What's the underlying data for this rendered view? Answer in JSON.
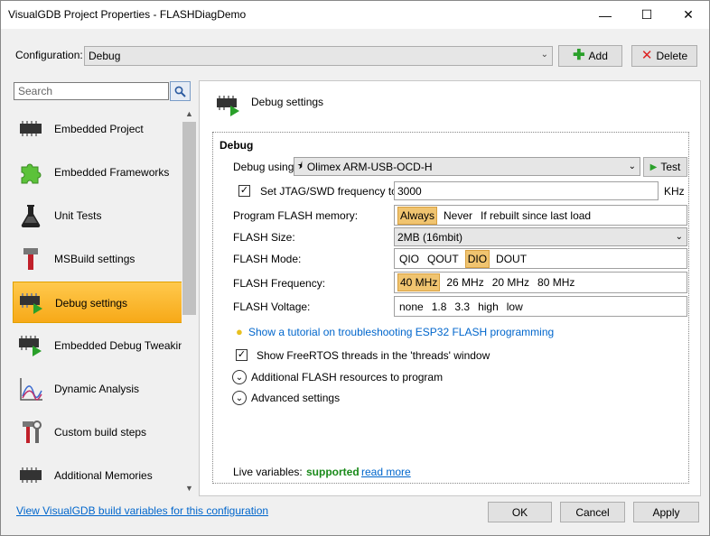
{
  "window": {
    "title": "VisualGDB Project Properties - FLASHDiagDemo"
  },
  "config": {
    "label": "Configuration:",
    "value": "Debug",
    "add_label": "Add",
    "delete_label": "Delete"
  },
  "search": {
    "placeholder": "Search"
  },
  "sidebar": {
    "items": [
      {
        "label": "Embedded Project",
        "icon": "chip-icon"
      },
      {
        "label": "Embedded Frameworks",
        "icon": "puzzle-icon"
      },
      {
        "label": "Unit Tests",
        "icon": "flask-icon"
      },
      {
        "label": "MSBuild settings",
        "icon": "hammer-icon"
      },
      {
        "label": "Debug settings",
        "icon": "chip-play-icon",
        "selected": true
      },
      {
        "label": "Embedded Debug Tweaking",
        "icon": "chip-play-icon"
      },
      {
        "label": "Dynamic Analysis",
        "icon": "graph-icon"
      },
      {
        "label": "Custom build steps",
        "icon": "tools-icon"
      },
      {
        "label": "Additional Memories",
        "icon": "chip-icon"
      }
    ]
  },
  "content": {
    "title": "Debug settings",
    "group_title": "Debug",
    "debug_using_label": "Debug using:",
    "debug_using_value": "Olimex ARM-USB-OCD-H",
    "test_label": "Test",
    "jtag_label": "Set JTAG/SWD frequency to:",
    "jtag_value": "3000",
    "jtag_unit": "KHz",
    "program_flash_label": "Program FLASH memory:",
    "program_flash_options": [
      "Always",
      "Never",
      "If rebuilt since last load"
    ],
    "flash_size_label": "FLASH Size:",
    "flash_size_value": "2MB (16mbit)",
    "flash_mode_label": "FLASH Mode:",
    "flash_mode_options": [
      "QIO",
      "QOUT",
      "DIO",
      "DOUT"
    ],
    "flash_freq_label": "FLASH Frequency:",
    "flash_freq_options": [
      "40 MHz",
      "26 MHz",
      "20 MHz",
      "80 MHz"
    ],
    "flash_voltage_label": "FLASH Voltage:",
    "flash_voltage_options": [
      "none",
      "1.8",
      "3.3",
      "high",
      "low"
    ],
    "tutorial_link": "Show a tutorial on troubleshooting ESP32 FLASH programming",
    "freertos_label": "Show FreeRTOS threads in the 'threads' window",
    "additional_flash_label": "Additional FLASH resources to program",
    "advanced_label": "Advanced settings",
    "live_vars_label": "Live variables:",
    "live_vars_status": "supported",
    "read_more": "read more"
  },
  "footer": {
    "link": "View VisualGDB build variables for this configuration",
    "ok": "OK",
    "cancel": "Cancel",
    "apply": "Apply"
  },
  "colors": {
    "selected_item": "#f7a918",
    "option_on": "#f0c470",
    "link": "#0066cc",
    "supported": "#1a8a1a"
  }
}
